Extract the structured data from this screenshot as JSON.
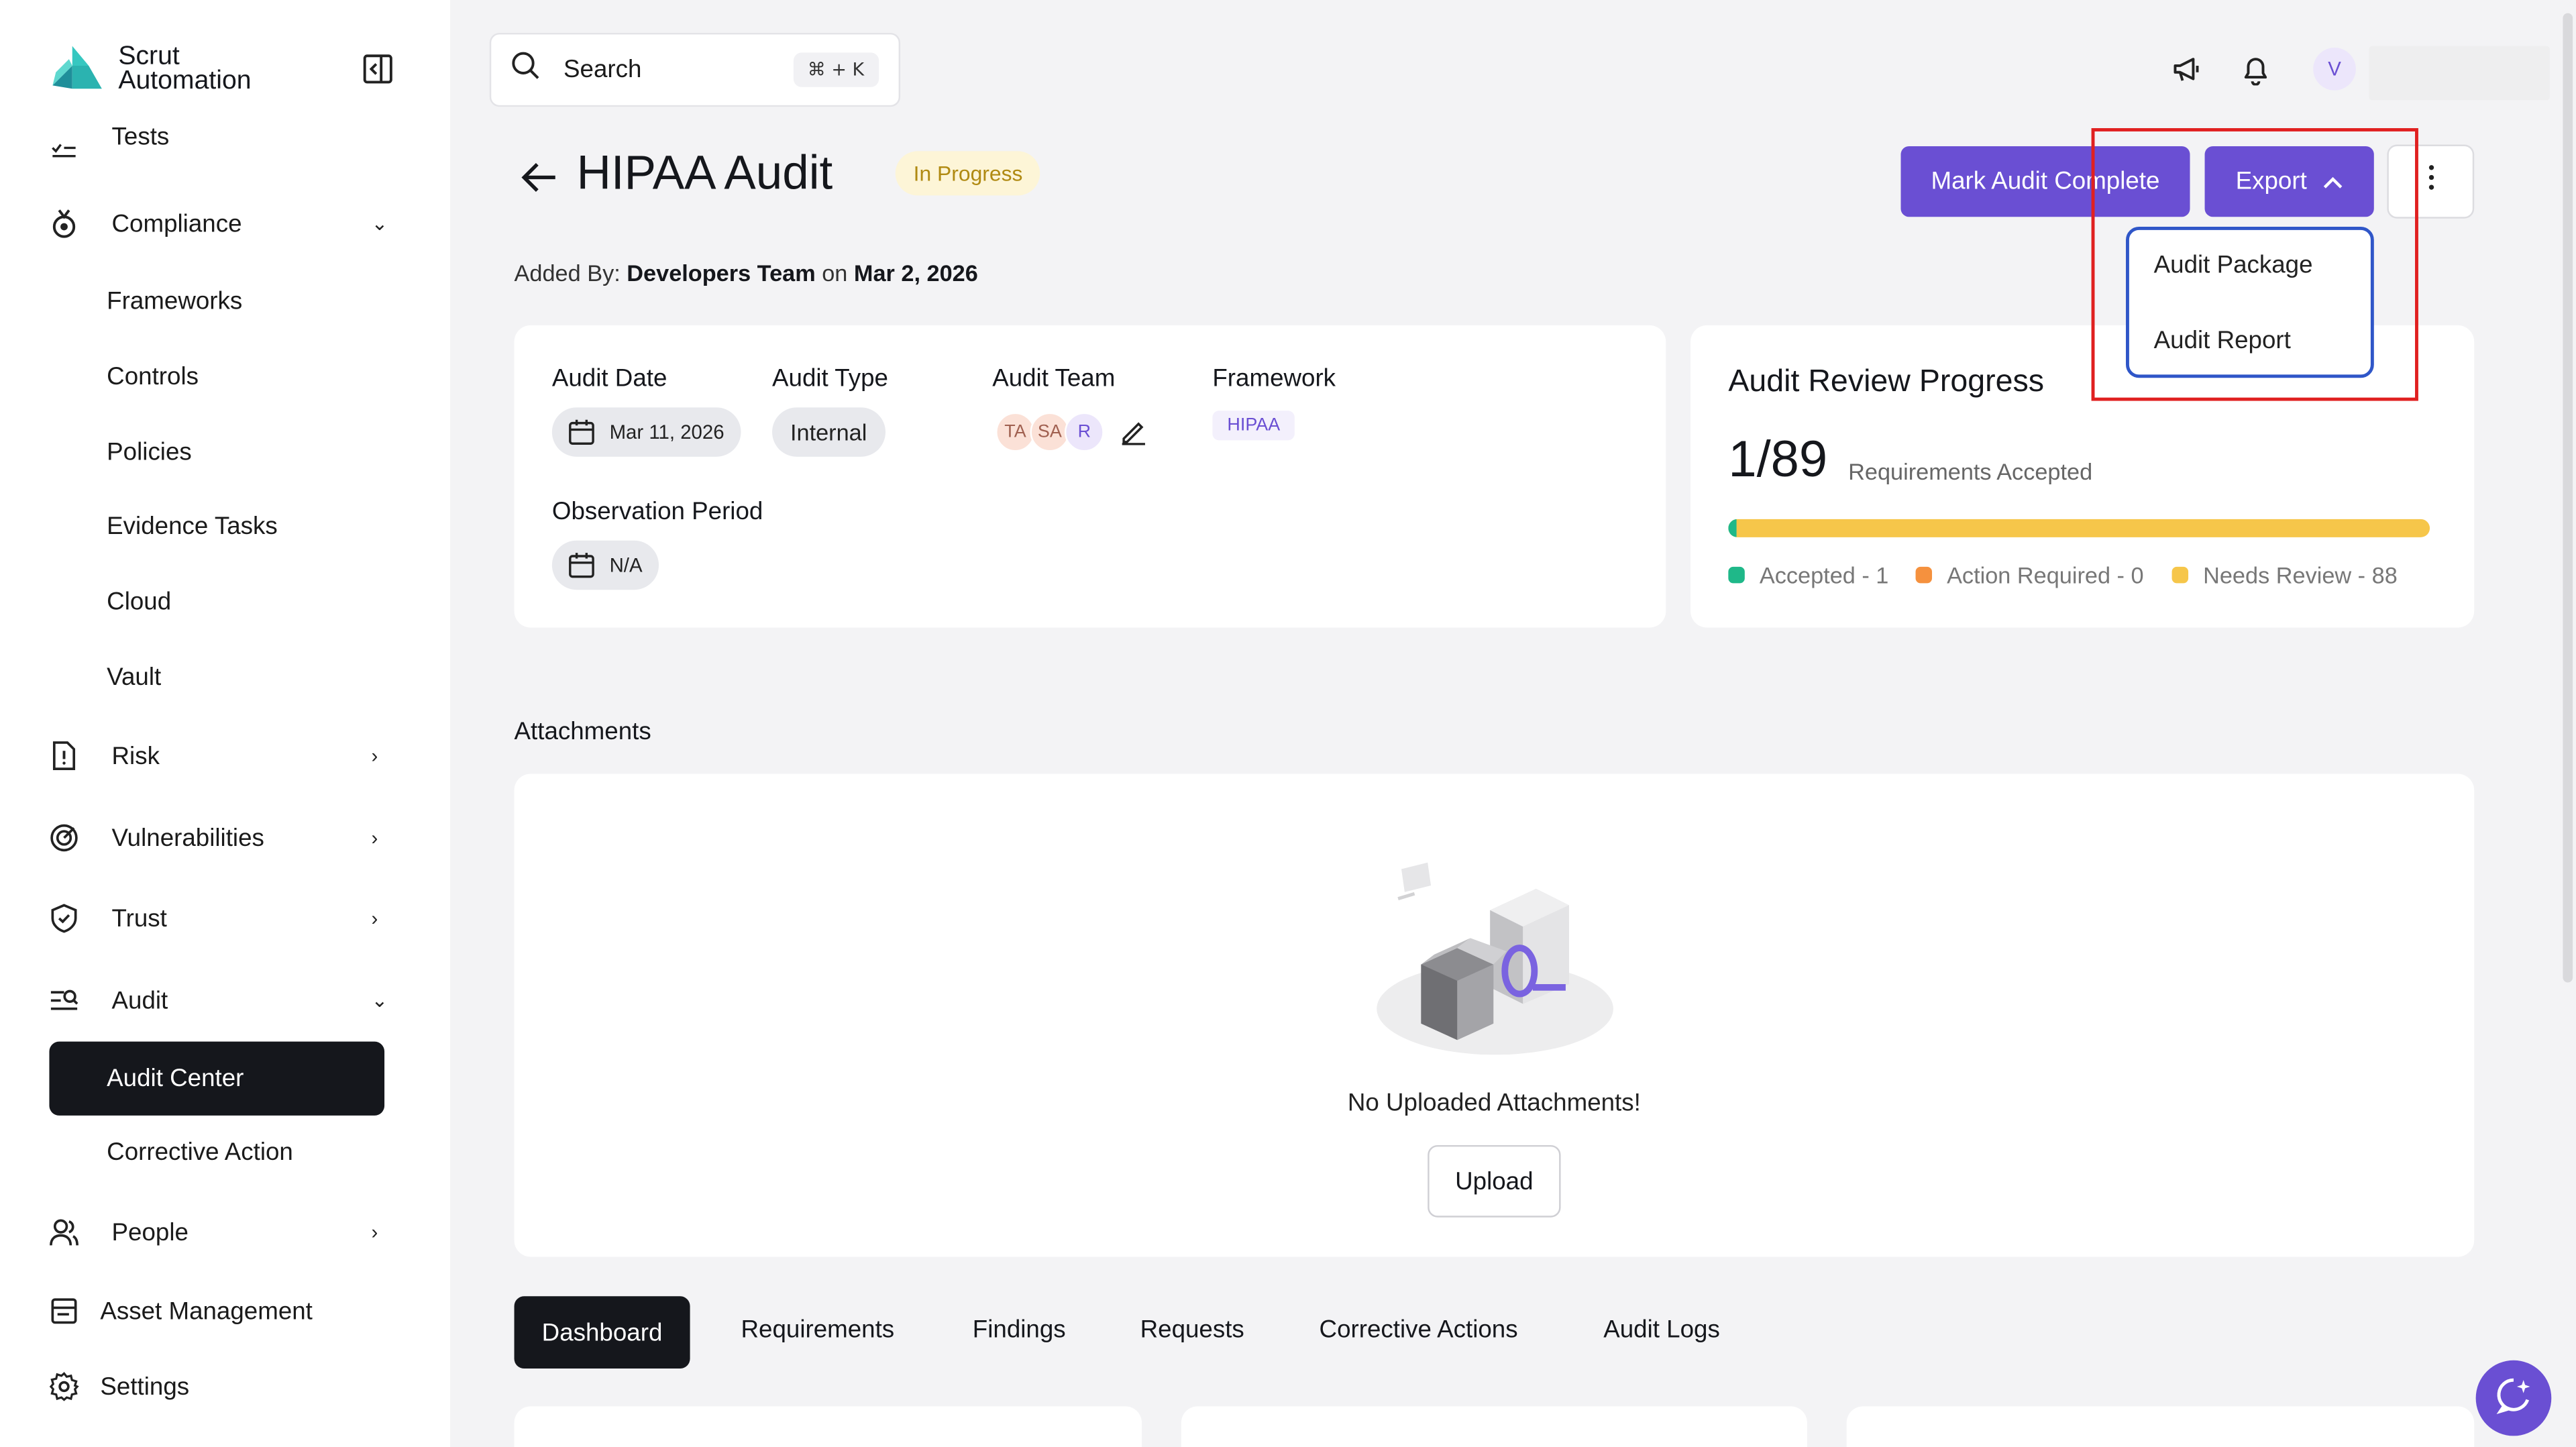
{
  "sidebar": {
    "brand_line1": "Scrut",
    "brand_line2": "Automation",
    "tests_label": "Tests",
    "compliance": "Compliance",
    "compliance_items": [
      "Frameworks",
      "Controls",
      "Policies",
      "Evidence Tasks",
      "Cloud",
      "Vault"
    ],
    "risk": "Risk",
    "vulnerabilities": "Vulnerabilities",
    "trust": "Trust",
    "audit": "Audit",
    "audit_items": [
      "Audit Center",
      "Corrective Action"
    ],
    "people": "People",
    "asset_management": "Asset Management",
    "settings": "Settings"
  },
  "topbar": {
    "search_label": "Search",
    "search_shortcut": "⌘ + K",
    "avatar_initial": "V"
  },
  "header": {
    "title": "HIPAA Audit",
    "status": "In Progress",
    "added_by_prefix": "Added By:",
    "added_by_name": "Developers Team",
    "added_on_prefix": "on",
    "added_on_date": "Mar 2, 2026",
    "mark_complete_label": "Mark Audit Complete",
    "export_label": "Export",
    "export_options": [
      "Audit Package",
      "Audit Report"
    ]
  },
  "details": {
    "audit_date_label": "Audit Date",
    "audit_date_value": "Mar 11, 2026",
    "audit_type_label": "Audit Type",
    "audit_type_value": "Internal",
    "audit_team_label": "Audit Team",
    "team_members": [
      "TA",
      "SA",
      "R"
    ],
    "framework_label": "Framework",
    "framework_value": "HIPAA",
    "observation_period_label": "Observation Period",
    "observation_period_value": "N/A"
  },
  "progress": {
    "title": "Audit Review Progress",
    "ratio": "1/89",
    "ratio_caption": "Requirements Accepted",
    "accepted": 1,
    "action_required": 0,
    "needs_review": 88,
    "total": 89,
    "legend_accepted": "Accepted - 1",
    "legend_action_required": "Action Required - 0",
    "legend_needs_review": "Needs Review - 88",
    "colors": {
      "accepted": "#1fb889",
      "action_required": "#f5913e",
      "needs_review": "#f6c64a"
    }
  },
  "attachments": {
    "title": "Attachments",
    "empty_text": "No Uploaded Attachments!",
    "upload_label": "Upload"
  },
  "tabs": [
    "Dashboard",
    "Requirements",
    "Findings",
    "Requests",
    "Corrective Actions",
    "Audit Logs"
  ],
  "colors": {
    "accent": "#6a4fd3",
    "dark": "#15171c",
    "highlight": "#e02020"
  }
}
